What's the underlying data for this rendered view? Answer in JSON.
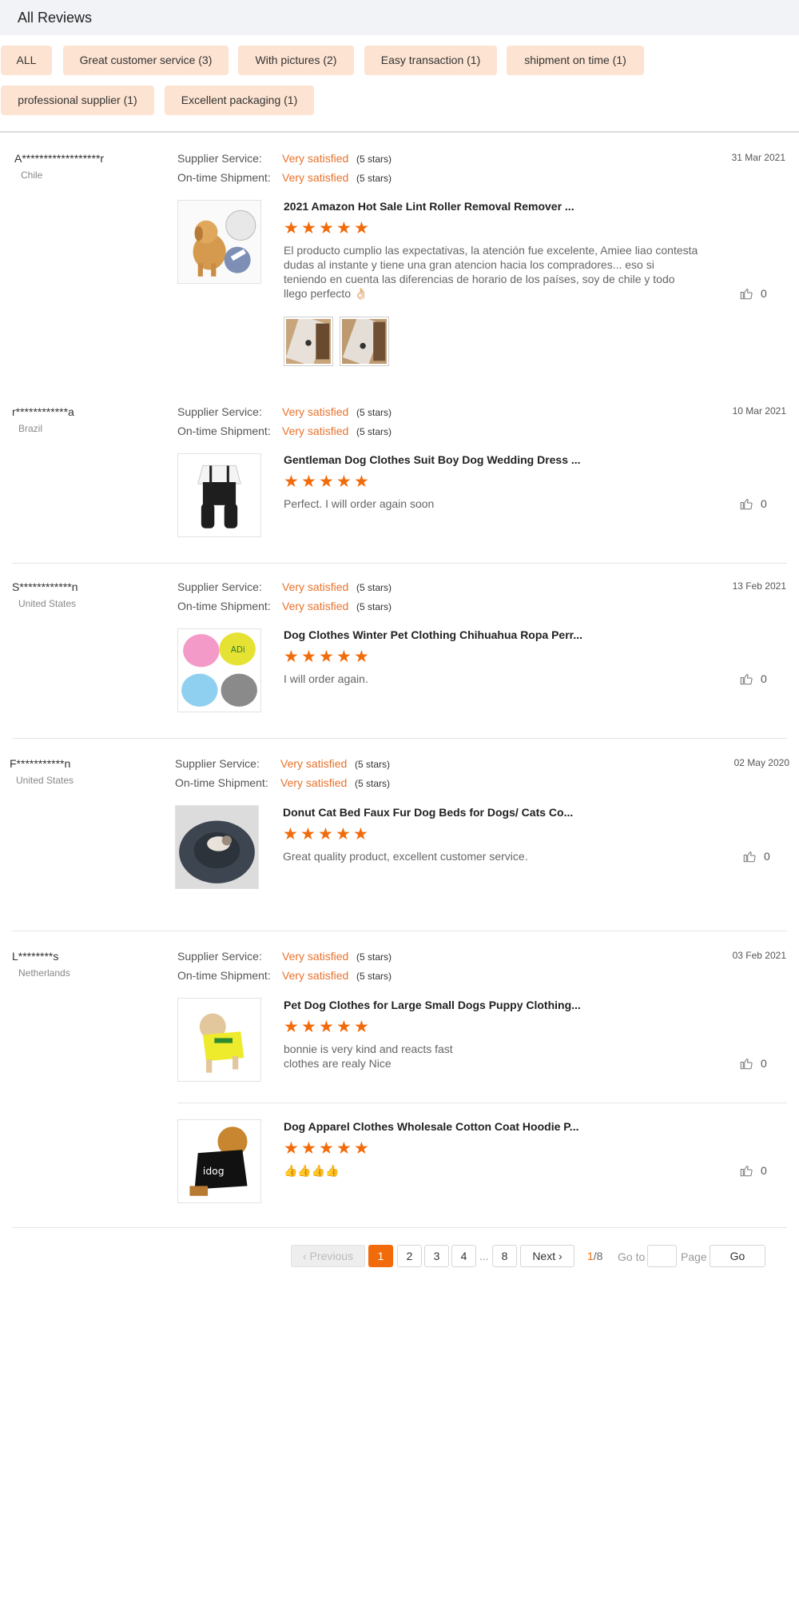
{
  "header": {
    "title": "All Reviews"
  },
  "filters": [
    "ALL",
    "Great customer service (3)",
    "With pictures (2)",
    "Easy transaction (1)",
    "shipment on time (1)",
    "professional supplier (1)",
    "Excellent packaging (1)"
  ],
  "labels": {
    "supplier_service": "Supplier Service:",
    "ontime_shipment": "On-time Shipment:",
    "rating_value": "Very satisfied",
    "rating_stars": "(5 stars)"
  },
  "reviews": [
    {
      "name": "A******************r",
      "country": "Chile",
      "date": "31 Mar 2021",
      "products": [
        {
          "title": "2021 Amazon Hot Sale Lint Roller Removal Remover ...",
          "rating": 5,
          "text": "El producto cumplio las expectativas, la atención fue excelente, Amiee liao contesta  dudas al instante y tiene una gran atencion hacia los compradores... eso si teniendo en cuenta las diferencias de horario de los países, soy de chile y todo llego perfecto 👌🏻",
          "likes": "0",
          "image": "dog-lint-roller-icon"
        }
      ]
    },
    {
      "name": "r************a",
      "country": "Brazil",
      "date": "10 Mar 2021",
      "products": [
        {
          "title": "Gentleman Dog Clothes Suit Boy Dog Wedding Dress ...",
          "rating": 5,
          "text": "Perfect. I will order again soon",
          "likes": "0",
          "image": "dog-suit-icon"
        }
      ]
    },
    {
      "name": "S************n",
      "country": "United States",
      "date": "13 Feb 2021",
      "products": [
        {
          "title": "Dog Clothes Winter Pet Clothing Chihuahua Ropa Perr...",
          "rating": 5,
          "text": "I will order again.",
          "likes": "0",
          "image": "dog-hoodies-icon"
        }
      ]
    },
    {
      "name": "F***********n",
      "country": "United States",
      "date": "02 May 2020",
      "products": [
        {
          "title": "Donut Cat Bed Faux Fur Dog Beds for Dogs/ Cats Co...",
          "rating": 5,
          "text": "Great quality product, excellent customer service.",
          "likes": "0",
          "image": "cat-bed-icon"
        }
      ]
    },
    {
      "name": "L********s",
      "country": "Netherlands",
      "date": "03 Feb 2021",
      "products": [
        {
          "title": "Pet Dog Clothes for Large Small Dogs Puppy Clothing...",
          "rating": 5,
          "text": "bonnie is very kind and reacts fast\nclothes are realy Nice",
          "likes": "0",
          "image": "dog-yellow-hoodie-icon"
        },
        {
          "title": "Dog Apparel Clothes Wholesale Cotton Coat Hoodie P...",
          "rating": 5,
          "text": "👍👍👍👍",
          "likes": "0",
          "image": "dog-black-hoodie-icon"
        }
      ]
    }
  ],
  "pagination": {
    "previous": "Previous",
    "pages": [
      "1",
      "2",
      "3",
      "4",
      "...",
      "8"
    ],
    "current": "1",
    "next": "Next",
    "current_of": "1",
    "total": "/8",
    "goto": "Go to",
    "page": "Page",
    "go": "Go"
  },
  "colors": {
    "accent": "#f26b0b",
    "rating_text": "#e8722c",
    "filter_bg": "#fde3d1",
    "header_bg": "#f2f3f7"
  }
}
